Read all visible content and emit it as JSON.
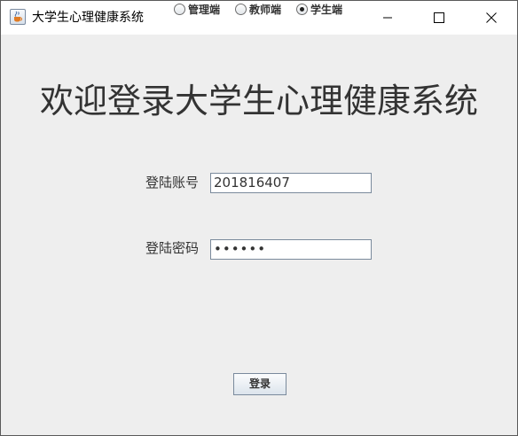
{
  "window": {
    "title": "大学生心理健康系统",
    "icon": "java-coffee-icon",
    "controls": {
      "minimize_icon": "minimize-icon",
      "maximize_icon": "maximize-icon",
      "close_icon": "close-icon"
    }
  },
  "main": {
    "headline": "欢迎登录大学生心理健康系统",
    "account": {
      "label": "登陆账号",
      "value": "201816407"
    },
    "password": {
      "label": "登陆密码",
      "masked_value": "••••••"
    },
    "roles": {
      "options": [
        {
          "label": "管理端",
          "selected": false
        },
        {
          "label": "教师端",
          "selected": false
        },
        {
          "label": "学生端",
          "selected": true
        }
      ]
    },
    "login_label": "登录"
  },
  "colors": {
    "window_background": "#eeeeee",
    "titlebar_background": "#ffffff",
    "text": "#333333",
    "field_border": "#7a8a9c"
  }
}
